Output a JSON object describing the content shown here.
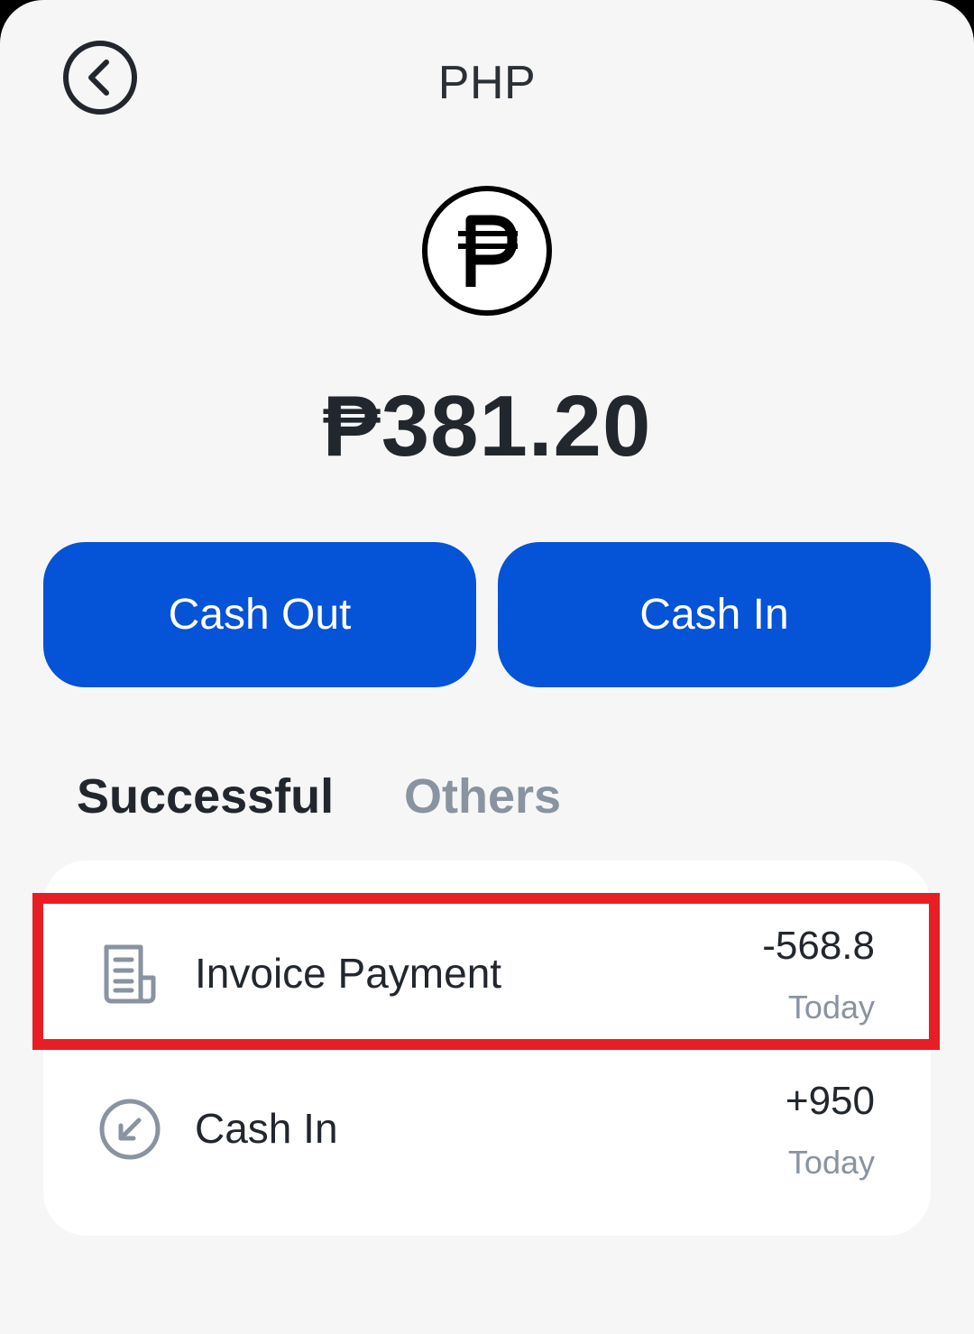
{
  "header": {
    "title": "PHP",
    "back_icon": "chevron-left-circle-icon"
  },
  "wallet": {
    "currency_icon": "peso-sign-icon",
    "balance": "₱381.20"
  },
  "actions": {
    "cash_out_label": "Cash Out",
    "cash_in_label": "Cash In"
  },
  "tabs": [
    {
      "label": "Successful",
      "active": true
    },
    {
      "label": "Others",
      "active": false
    }
  ],
  "transactions": [
    {
      "icon": "invoice-icon",
      "title": "Invoice Payment",
      "amount": "-568.8",
      "date": "Today",
      "highlighted": true
    },
    {
      "icon": "arrow-down-left-circle-icon",
      "title": "Cash In",
      "amount": "+950",
      "date": "Today",
      "highlighted": false
    }
  ],
  "colors": {
    "primary": "#0553d6",
    "highlight": "#e81e25",
    "text_dark": "#22272e",
    "text_muted": "#8a93a0",
    "background": "#f6f6f7"
  }
}
